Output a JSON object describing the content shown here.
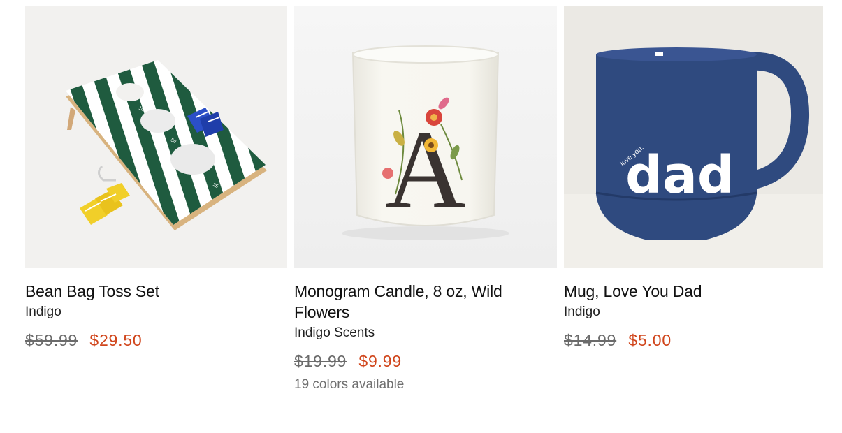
{
  "products": [
    {
      "title": "Bean Bag Toss Set",
      "brand": "Indigo",
      "was_price": "$59.99",
      "sale_price": "$29.50",
      "board_marks": [
        "100",
        "50",
        "25"
      ]
    },
    {
      "title": "Monogram Candle, 8 oz, Wild Flowers",
      "brand": "Indigo Scents",
      "was_price": "$19.99",
      "sale_price": "$9.99",
      "colors_note": "19 colors available",
      "monogram_letter": "A"
    },
    {
      "title": "Mug, Love You Dad",
      "brand": "Indigo",
      "was_price": "$14.99",
      "sale_price": "$5.00",
      "mug_small_text": "love you,",
      "mug_large_text": "dad"
    }
  ],
  "colors": {
    "sale_price": "#d0451b",
    "was_price": "#6b6b6b",
    "board_green": "#1f5b3f",
    "mug_blue": "#2f4a7f"
  }
}
